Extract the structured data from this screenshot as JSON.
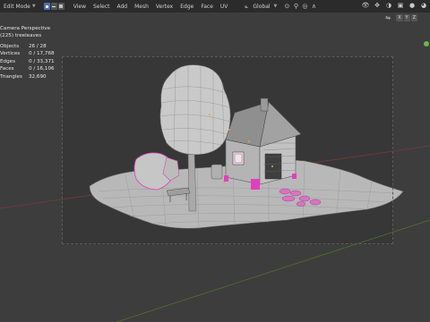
{
  "header": {
    "mode_label": "Edit Mode",
    "menus": [
      "View",
      "Select",
      "Add",
      "Mesh",
      "Vertex",
      "Edge",
      "Face",
      "UV"
    ],
    "orientation_label": "Global",
    "axis_toggles": [
      "X",
      "Y",
      "Z"
    ]
  },
  "viewport": {
    "view_name": "Camera Perspective",
    "object_name": "(225) treeleaves",
    "stats": [
      {
        "label": "Objects",
        "value": "26 / 28"
      },
      {
        "label": "Vertices",
        "value": "0 / 17,768"
      },
      {
        "label": "Edges",
        "value": "0 / 33,371"
      },
      {
        "label": "Faces",
        "value": "0 / 16,106"
      },
      {
        "label": "Triangles",
        "value": "32,690"
      }
    ]
  },
  "colors": {
    "accent_select": "#4772b3",
    "selection_pink": "#e23fbf",
    "axis_red": "#8a3c3c",
    "axis_green": "#5b7a2e",
    "gizmo_green": "#6fb64a"
  }
}
